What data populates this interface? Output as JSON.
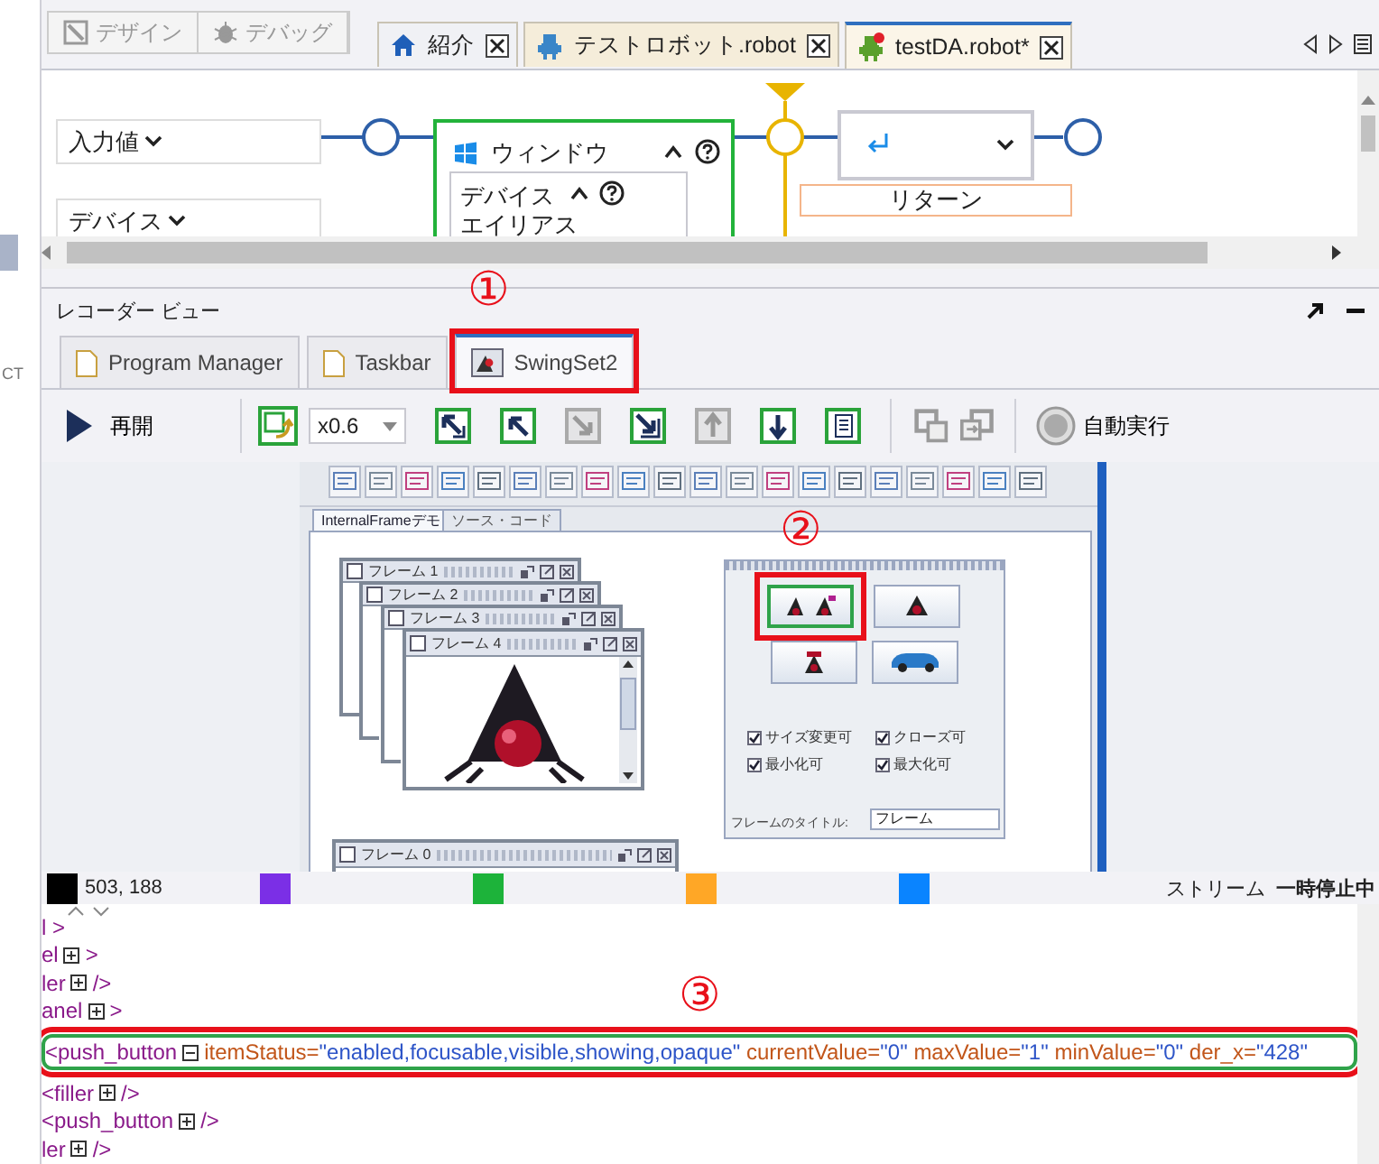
{
  "left_panel": {
    "text": "CT"
  },
  "mode_buttons": [
    {
      "label": "デザイン",
      "kind": "design",
      "disabled": true
    },
    {
      "label": "デバッグ",
      "kind": "debug",
      "disabled": true
    }
  ],
  "editor_tabs": [
    {
      "label": "紹介",
      "kind": "home",
      "selected": false,
      "modified": false
    },
    {
      "label": "テストロボット.robot",
      "kind": "robot",
      "selected": false,
      "modified": false
    },
    {
      "label": "testDA.robot*",
      "kind": "robot",
      "selected": true,
      "modified": true
    }
  ],
  "flow": {
    "inputs": [
      {
        "label": "入力値"
      },
      {
        "label": "デバイス"
      }
    ],
    "window_step": {
      "title": "ウィンドウ",
      "fields": [
        "デバイス",
        "エイリアス"
      ]
    },
    "return_step": {
      "label": "リターン"
    }
  },
  "recorder": {
    "title": "レコーダー ビュー",
    "tabs": [
      {
        "label": "Program Manager",
        "selected": false,
        "annotated": false
      },
      {
        "label": "Taskbar",
        "selected": false,
        "annotated": false
      },
      {
        "label": "SwingSet2",
        "selected": true,
        "annotated": true
      }
    ],
    "toolbar": {
      "resume": "再開",
      "zoom": "x0.6",
      "tools": [
        {
          "kind": "arrow-nw-bar",
          "disabled": false
        },
        {
          "kind": "arrow-nw",
          "disabled": false
        },
        {
          "kind": "arrow-se",
          "disabled": true
        },
        {
          "kind": "arrow-se-bar",
          "disabled": false
        },
        {
          "kind": "arrow-up",
          "disabled": true
        },
        {
          "kind": "arrow-down",
          "disabled": false
        },
        {
          "kind": "document",
          "disabled": false
        }
      ],
      "window_tools": [
        {
          "kind": "window-out",
          "disabled": true
        },
        {
          "kind": "window-in",
          "disabled": true
        }
      ],
      "auto_run": "自動実行"
    }
  },
  "preview": {
    "tabs": [
      {
        "label": "InternalFrameデモ",
        "selected": true
      },
      {
        "label": "ソース・コード",
        "selected": false
      }
    ],
    "frames": [
      {
        "title": "フレーム 1"
      },
      {
        "title": "フレーム 2"
      },
      {
        "title": "フレーム 3"
      },
      {
        "title": "フレーム 4"
      },
      {
        "title": "フレーム 0"
      }
    ],
    "buttons": [
      {
        "kind": "two-mascots",
        "selected": true,
        "annotated": true
      },
      {
        "kind": "mascot",
        "selected": false
      },
      {
        "kind": "mascot-small",
        "selected": false
      },
      {
        "kind": "car",
        "selected": false
      }
    ],
    "checkboxes": [
      {
        "label": "サイズ変更可",
        "checked": true
      },
      {
        "label": "クローズ可",
        "checked": true
      },
      {
        "label": "最小化可",
        "checked": true
      },
      {
        "label": "最大化可",
        "checked": true
      }
    ],
    "title_label": "フレームのタイトル:",
    "title_value": "フレーム"
  },
  "status": {
    "swatches": [
      {
        "color": "#000000",
        "text": "503, 188"
      },
      {
        "color": "#7b2fe6"
      },
      {
        "color": "#1db33a"
      },
      {
        "color": "#ffa726"
      },
      {
        "color": "#0a84ff"
      }
    ],
    "stream_label": "ストリーム",
    "stream_state": "一時停止中"
  },
  "tree": {
    "lines": [
      {
        "kind": "text",
        "text": "l >",
        "selected": false
      },
      {
        "kind": "node",
        "tag": "el",
        "expanded": false,
        "close": ">",
        "selected": false
      },
      {
        "kind": "node",
        "tag": "ler",
        "expanded": false,
        "close": "/>",
        "selected": false
      },
      {
        "kind": "node",
        "tag": "anel",
        "expanded": false,
        "close": ">",
        "selected": false
      },
      {
        "kind": "node",
        "tag": "<push_button",
        "expanded": true,
        "selected": true,
        "annotated": true,
        "attributes": [
          {
            "name": "itemStatus=",
            "value": "\"enabled,focusable,visible,showing,opaque\""
          },
          {
            "name": "currentValue=",
            "value": "\"0\""
          },
          {
            "name": "maxValue=",
            "value": "\"1\""
          },
          {
            "name": "minValue=",
            "value": "\"0\""
          },
          {
            "name": "der_x=",
            "value": "\"428\""
          }
        ]
      },
      {
        "kind": "node",
        "tag": "<filler",
        "expanded": false,
        "close": "/>",
        "selected": false
      },
      {
        "kind": "node",
        "tag": "<push_button",
        "expanded": false,
        "close": "/>",
        "selected": false
      },
      {
        "kind": "node",
        "tag": "ler",
        "expanded": false,
        "close": "/>",
        "selected": false
      }
    ]
  },
  "callouts": [
    "①",
    "②",
    "③"
  ]
}
